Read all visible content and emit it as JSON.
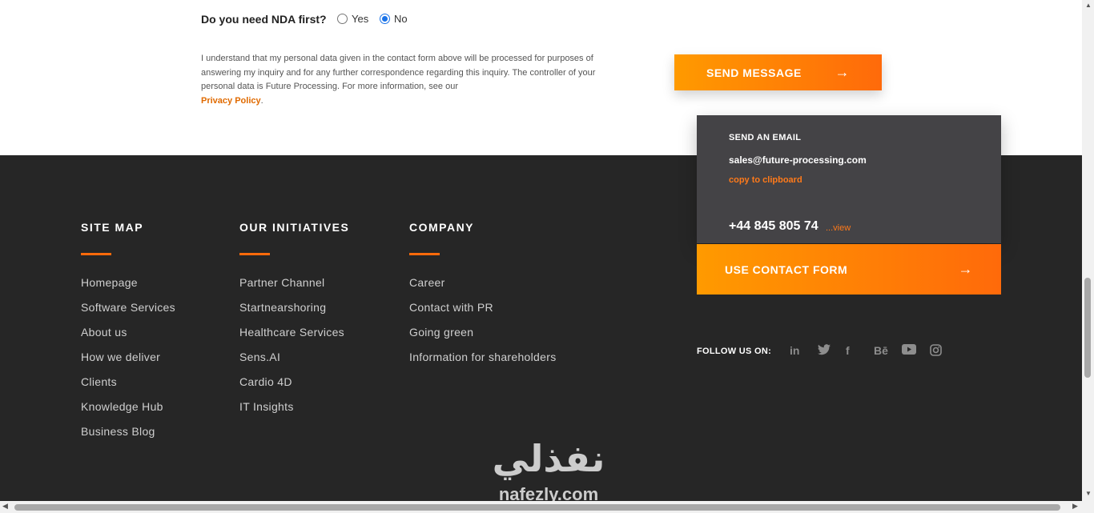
{
  "form": {
    "nda_question": "Do you need NDA first?",
    "nda_options": [
      {
        "label": "Yes",
        "checked": false
      },
      {
        "label": "No",
        "checked": true
      }
    ],
    "consent_text": "I understand that my personal data given in the contact form above will be processed for purposes of answering my inquiry and for any further correspondence regarding this inquiry. The controller of your personal data is Future Processing. For more information, see our",
    "privacy_link": "Privacy Policy",
    "consent_end": ".",
    "send_label": "SEND MESSAGE",
    "send_arrow": "→"
  },
  "footer": {
    "columns": [
      {
        "title": "SITE MAP",
        "items": [
          "Homepage",
          "Software Services",
          "About us",
          "How we deliver",
          "Clients",
          "Knowledge Hub",
          "Business Blog"
        ]
      },
      {
        "title": "OUR INITIATIVES",
        "items": [
          "Partner Channel",
          "Startnearshoring",
          "Healthcare Services",
          "Sens.AI",
          "Cardio 4D",
          "IT Insights"
        ]
      },
      {
        "title": "COMPANY",
        "items": [
          "Career",
          "Contact with PR",
          "Going green",
          "Information for shareholders"
        ]
      }
    ],
    "contact": {
      "send_email_label": "SEND AN EMAIL",
      "email": "sales@future-processing.com",
      "copy_label": "copy to clipboard",
      "phone": "+44 845 805 74",
      "view_label": "...view",
      "contact_form_label": "USE CONTACT FORM",
      "contact_form_arrow": "→"
    },
    "follow_label": "FOLLOW US ON:",
    "socials": [
      {
        "icon": "linkedin-icon",
        "glyph": "in"
      },
      {
        "icon": "twitter-icon",
        "glyph": "🐦"
      },
      {
        "icon": "facebook-icon",
        "glyph": "f"
      },
      {
        "icon": "behance-icon",
        "glyph": "Bē"
      },
      {
        "icon": "youtube-icon",
        "glyph": "▶"
      },
      {
        "icon": "instagram-icon",
        "glyph": "◎"
      }
    ]
  },
  "watermark": {
    "arabic": "نفذلي",
    "latin": "nafezly.com"
  },
  "colors": {
    "accent": "#ff6a0a",
    "accent_start": "#ff9a00",
    "footer_bg": "#262626",
    "card_bg": "#444346"
  }
}
